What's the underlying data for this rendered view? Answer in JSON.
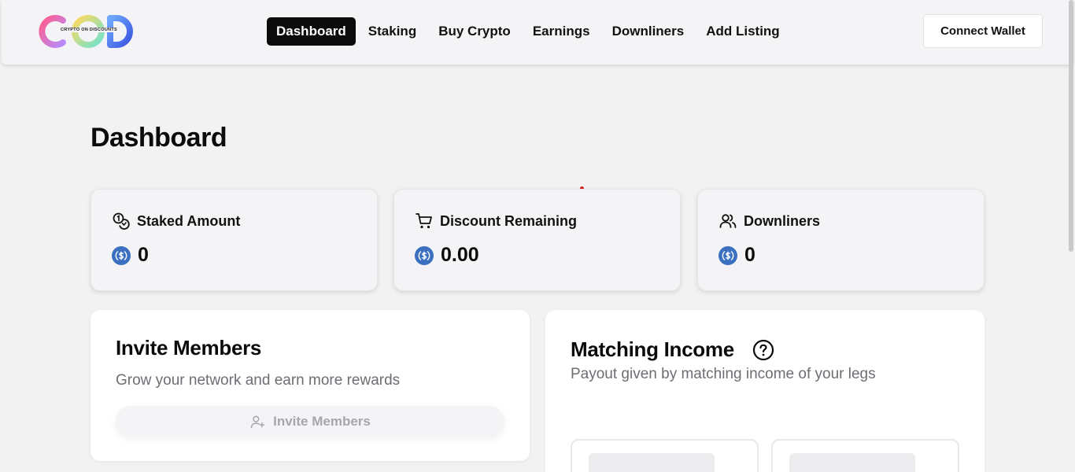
{
  "brand": {
    "logo_text": "CRYPTO ON DISCOUNTS"
  },
  "nav": {
    "items": [
      {
        "label": "Dashboard",
        "active": true
      },
      {
        "label": "Staking",
        "active": false
      },
      {
        "label": "Buy Crypto",
        "active": false
      },
      {
        "label": "Earnings",
        "active": false
      },
      {
        "label": "Downliners",
        "active": false
      },
      {
        "label": "Add Listing",
        "active": false
      }
    ],
    "connect_label": "Connect Wallet"
  },
  "page": {
    "title": "Dashboard"
  },
  "stats": [
    {
      "label": "Staked Amount",
      "value": "0",
      "icon": "coins-icon"
    },
    {
      "label": "Discount Remaining",
      "value": "0.00",
      "icon": "cart-icon"
    },
    {
      "label": "Downliners",
      "value": "0",
      "icon": "users-icon"
    }
  ],
  "invite": {
    "title": "Invite Members",
    "subtitle": "Grow your network and earn more rewards",
    "button_label": "Invite Members"
  },
  "matching": {
    "title": "Matching Income",
    "subtitle": "Payout given by matching income of your legs"
  },
  "colors": {
    "accent": "#0b0b0c",
    "usdc": "#3b6fc0",
    "background": "#f2f2f3",
    "dot": "#d62020"
  }
}
